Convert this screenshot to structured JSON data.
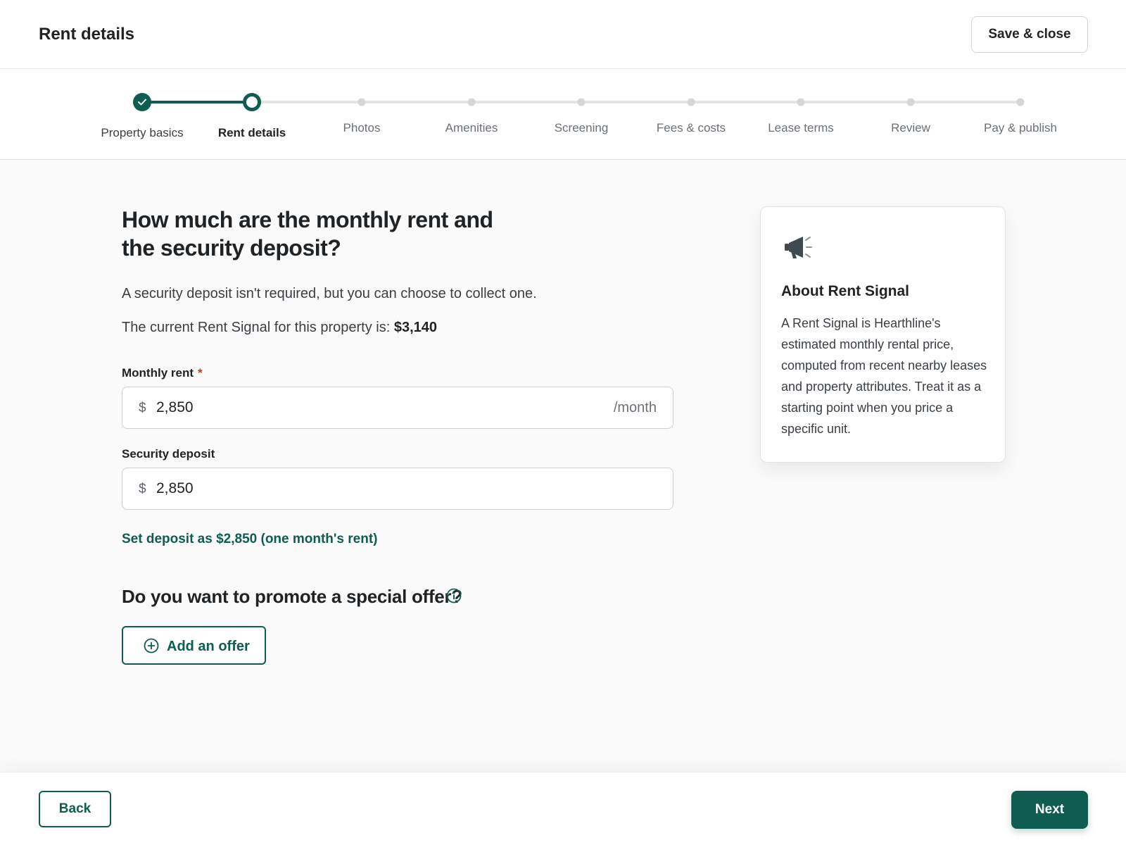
{
  "header": {
    "title": "Rent details",
    "save_label": "Save & close"
  },
  "stepper": {
    "steps": [
      {
        "label": "Property basics",
        "state": "complete"
      },
      {
        "label": "Rent details",
        "state": "current"
      },
      {
        "label": "Photos",
        "state": "pending"
      },
      {
        "label": "Amenities",
        "state": "pending"
      },
      {
        "label": "Screening",
        "state": "pending"
      },
      {
        "label": "Fees & costs",
        "state": "pending"
      },
      {
        "label": "Lease terms",
        "state": "pending"
      },
      {
        "label": "Review",
        "state": "pending"
      },
      {
        "label": "Pay & publish",
        "state": "pending"
      }
    ]
  },
  "main": {
    "question": "How much are the monthly rent and the security deposit?",
    "deposit_note": "A security deposit isn't required, but you can choose to collect one.",
    "rent_signal_prefix": "The current Rent Signal for this property is:",
    "rent_signal_value": "$3,140",
    "monthly_rent": {
      "label": "Monthly rent",
      "required_mark": "*",
      "currency": "$",
      "value": "2,850",
      "suffix": "/month"
    },
    "security_deposit": {
      "label": "Security deposit",
      "currency": "$",
      "value": "2,850"
    },
    "set_deposit_link": "Set deposit as $2,850 (one month's rent)",
    "offer_question": "Do you want to promote a special offer?",
    "add_offer_label": "Add an offer"
  },
  "info_card": {
    "icon": "megaphone-icon",
    "title": "About Rent Signal",
    "body": "A Rent Signal is Hearthline's estimated monthly rental price, computed from recent nearby leases and property attributes. Treat it as a starting point when you price a specific unit."
  },
  "footer": {
    "back_label": "Back",
    "next_label": "Next"
  },
  "colors": {
    "accent": "#0f5c50",
    "required": "#c0392b",
    "track_pending": "#e4e4e4"
  }
}
